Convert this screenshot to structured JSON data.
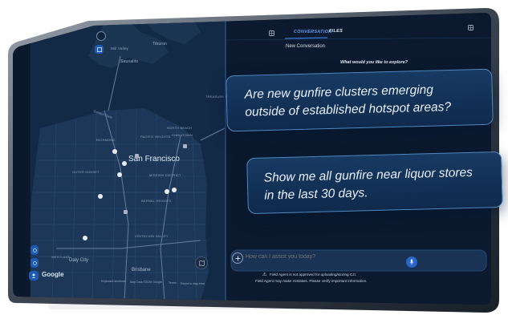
{
  "tabs": {
    "conversation": "CONVERSATION",
    "files": "FILES"
  },
  "panel": {
    "title": "New Conversation",
    "prompt_heading": "What would you like to explore?"
  },
  "bubbles": [
    {
      "line1": "Are new gunfire clusters emerging",
      "line2": "outside of established hotspot areas?"
    },
    {
      "line1": "Show me all gunfire near liquor stores",
      "line2": "in the last 30 days."
    }
  ],
  "input": {
    "placeholder": "How can I assist you today?"
  },
  "disclaimer": {
    "line1": "Field Agent is not approved for uploading/storing CJI.",
    "line2": "Field Agent may make mistakes. Please verify important information."
  },
  "map": {
    "city": "San Francisco",
    "labels": {
      "tiburon": "Tiburon",
      "sausalito": "Sausalito",
      "mill_valley": "Mill Valley",
      "golden_gate": "Golden Gate",
      "richmond": "RICHMOND",
      "pacific_heights": "PACIFIC HEIGHTS",
      "north_beach": "NORTH BEACH",
      "chinatown": "CHINATOWN",
      "outer_sunset": "OUTER SUNSET",
      "mission": "MISSION DISTRICT",
      "bernal": "BERNAL HEIGHTS",
      "visitacion": "VISITACION VALLEY",
      "daly_city": "Daly City",
      "westlake": "WESTLAKE",
      "brisbane": "Brisbane",
      "treasure_island": "TREASURE ISLAND"
    },
    "attribution": {
      "google": "Google",
      "keyboard": "Keyboard shortcuts",
      "map_data": "Map Data ©2026 Google",
      "terms": "Terms",
      "report": "Report a map error"
    }
  },
  "colors": {
    "bubble_border": "#4f8ac4",
    "bubble_bg": "#12305a",
    "screen_bg": "#0b1a2e",
    "accent": "#3a78d8"
  }
}
